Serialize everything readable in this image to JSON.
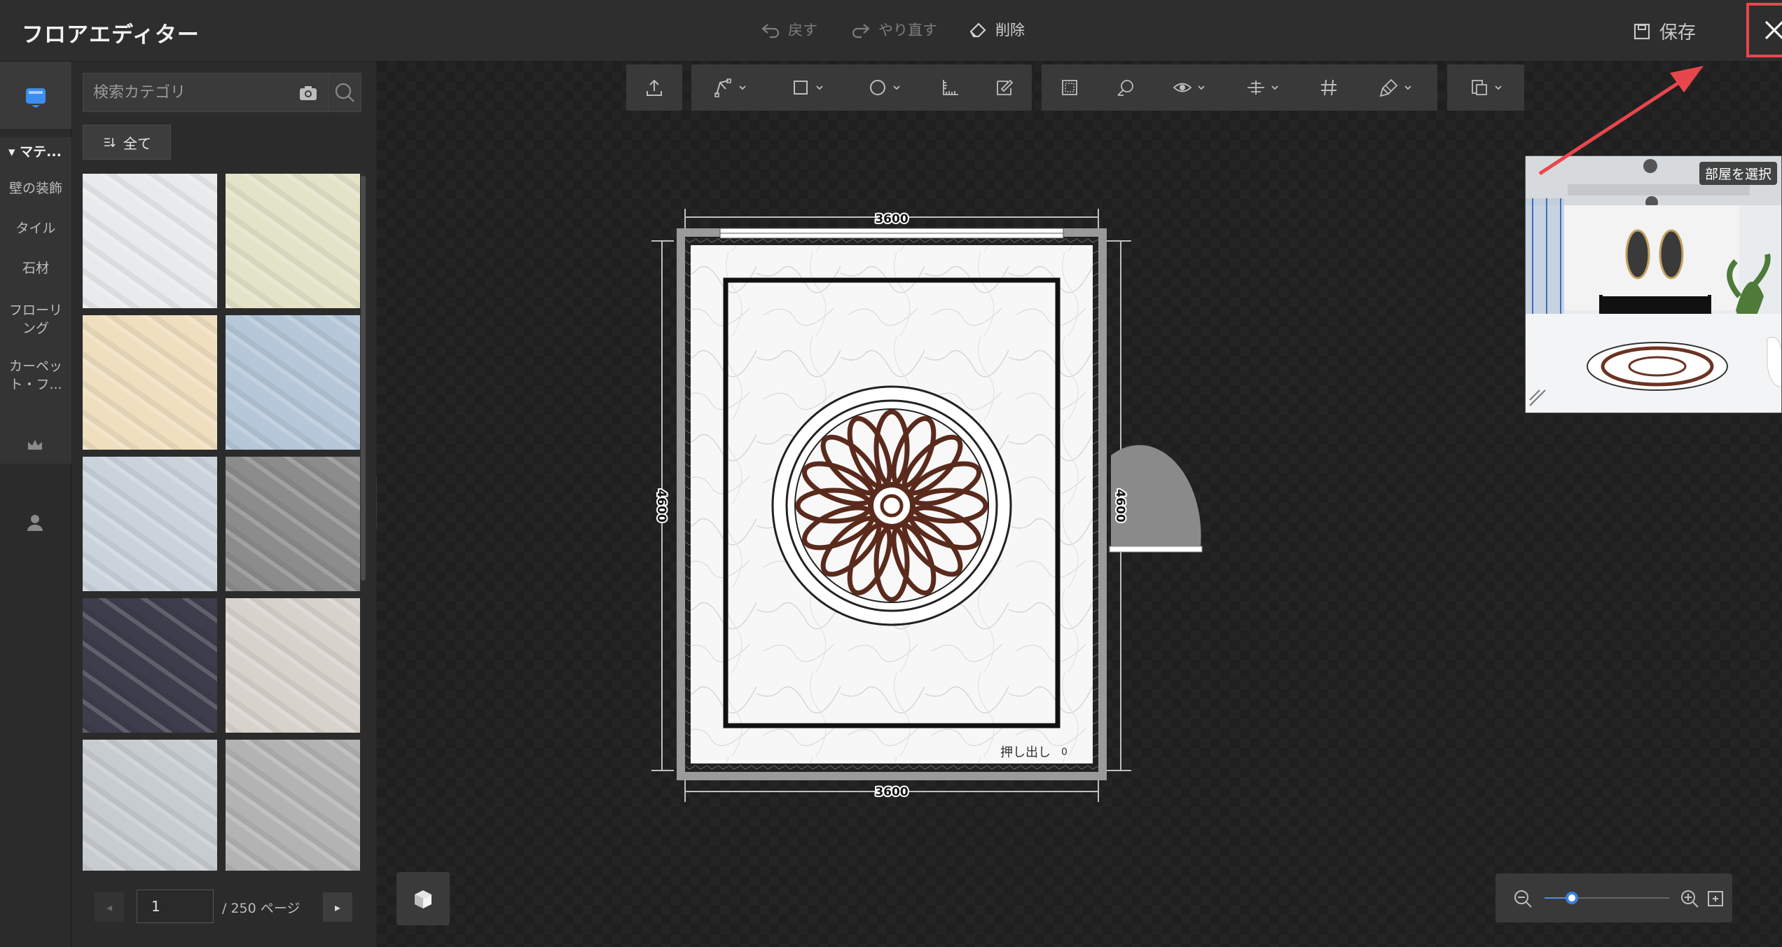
{
  "header": {
    "title": "フロアエディター",
    "undo_label": "戻す",
    "redo_label": "やり直す",
    "delete_label": "削除",
    "save_label": "保存",
    "close_icon": "close-icon"
  },
  "rail": {
    "category_title": "マテ...",
    "items": [
      {
        "label": "壁の装飾"
      },
      {
        "label": "タイル"
      },
      {
        "label": "石材"
      },
      {
        "label": "フローリ ング"
      },
      {
        "label": "カーペッ ト・フ..."
      }
    ]
  },
  "panel": {
    "search_placeholder": "検索カテゴリ",
    "filter_all_label": "全て",
    "tiles": [
      {
        "name": "white-marble",
        "color": "#e8eaeb"
      },
      {
        "name": "cream-marble-tile",
        "color": "#e3e3c8"
      },
      {
        "name": "beige-tile",
        "color": "#efdfbf"
      },
      {
        "name": "blue-grey-marble",
        "color": "#b5c7d8"
      },
      {
        "name": "light-blue-marble",
        "color": "#cad3dc"
      },
      {
        "name": "grey-stone",
        "color": "#8c8c8c"
      },
      {
        "name": "dark-purple-marble",
        "color": "#3d3d4c"
      },
      {
        "name": "white-brown-granite",
        "color": "#d8d2cc"
      },
      {
        "name": "grey-white-marble",
        "color": "#c7ccd0"
      },
      {
        "name": "light-grey-stone",
        "color": "#b3b3b3"
      }
    ]
  },
  "pager": {
    "current_page": "1",
    "total_label": "/ 250 ページ"
  },
  "plan": {
    "width_label_top": "3600",
    "width_label_bottom": "3600",
    "height_label_left": "4600",
    "height_label_right": "4600",
    "extrude_label": "押し出し",
    "extrude_value": "0"
  },
  "preview": {
    "label": "部屋を選択"
  },
  "zoom": {
    "level": 0.22
  },
  "colors": {
    "accent": "#3a80e0",
    "close_highlight": "#e8464d",
    "medallion": "#5a2a1c"
  }
}
